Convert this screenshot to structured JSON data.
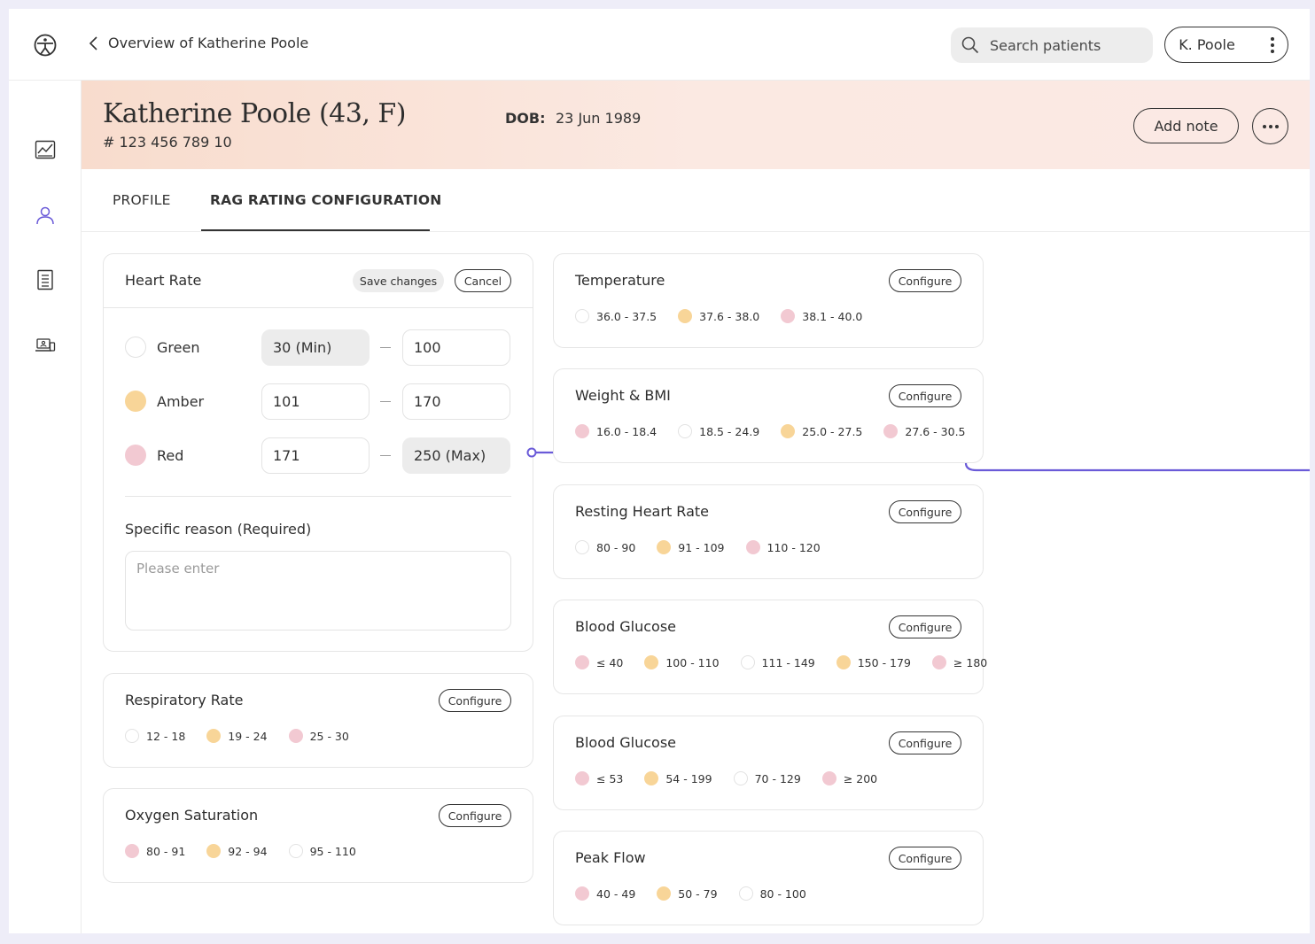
{
  "topbar": {
    "back_label": "Overview of Katherine Poole",
    "search_placeholder": "Search patients",
    "user_label": "K. Poole"
  },
  "sidebar": {
    "items": [
      {
        "name": "analytics",
        "icon": "chart-icon"
      },
      {
        "name": "patients",
        "icon": "user-icon",
        "active": true
      },
      {
        "name": "documents",
        "icon": "document-icon"
      },
      {
        "name": "devices",
        "icon": "devices-icon"
      }
    ]
  },
  "patient": {
    "name": "Katherine Poole (43, F)",
    "id": "# 123 456 789 10",
    "dob_label": "DOB:",
    "dob": "23 Jun 1989",
    "add_note_label": "Add note"
  },
  "tabs": [
    {
      "label": "PROFILE",
      "active": false
    },
    {
      "label": "RAG RATING CONFIGURATION",
      "active": true
    }
  ],
  "heart_rate": {
    "title": "Heart Rate",
    "save_label": "Save changes",
    "cancel_label": "Cancel",
    "rows": [
      {
        "label": "Green",
        "min": "30 (Min)",
        "max": "100"
      },
      {
        "label": "Amber",
        "min": "101",
        "max": "170"
      },
      {
        "label": "Red",
        "min": "171",
        "max": "250 (Max)"
      }
    ],
    "reason_label": "Specific reason (Required)",
    "reason_placeholder": "Please enter",
    "reason_value": ""
  },
  "configure_label": "Configure",
  "left_cards": [
    {
      "title": "Respiratory Rate",
      "chips": [
        {
          "color": "green",
          "text": "12 - 18"
        },
        {
          "color": "amber",
          "text": "19 - 24"
        },
        {
          "color": "red",
          "text": "25 - 30"
        }
      ]
    },
    {
      "title": "Oxygen Saturation",
      "chips": [
        {
          "color": "red",
          "text": "80 - 91"
        },
        {
          "color": "amber",
          "text": "92 - 94"
        },
        {
          "color": "green",
          "text": "95 - 110"
        }
      ]
    }
  ],
  "right_cards": [
    {
      "title": "Temperature",
      "chips": [
        {
          "color": "green",
          "text": "36.0 - 37.5"
        },
        {
          "color": "amber",
          "text": "37.6 - 38.0"
        },
        {
          "color": "red",
          "text": "38.1 - 40.0"
        }
      ]
    },
    {
      "title": "Weight & BMI",
      "chips": [
        {
          "color": "red",
          "text": "16.0 - 18.4"
        },
        {
          "color": "green",
          "text": "18.5 - 24.9"
        },
        {
          "color": "amber",
          "text": "25.0 - 27.5"
        },
        {
          "color": "red",
          "text": "27.6 - 30.5"
        }
      ]
    },
    {
      "title": "Resting Heart Rate",
      "chips": [
        {
          "color": "green",
          "text": "80 - 90"
        },
        {
          "color": "amber",
          "text": "91 - 109"
        },
        {
          "color": "red",
          "text": "110 - 120"
        }
      ]
    },
    {
      "title": "Blood Glucose",
      "chips": [
        {
          "color": "red",
          "text": "≤ 40"
        },
        {
          "color": "amber",
          "text": "100 - 110"
        },
        {
          "color": "green",
          "text": "111 - 149"
        },
        {
          "color": "amber",
          "text": "150 - 179"
        },
        {
          "color": "red",
          "text": "≥ 180"
        }
      ]
    },
    {
      "title": "Blood Glucose",
      "chips": [
        {
          "color": "red",
          "text": "≤ 53"
        },
        {
          "color": "amber",
          "text": "54 - 199"
        },
        {
          "color": "green",
          "text": "70 - 129"
        },
        {
          "color": "red",
          "text": "≥ 200"
        }
      ]
    },
    {
      "title": "Peak Flow",
      "chips": [
        {
          "color": "red",
          "text": "40 - 49"
        },
        {
          "color": "amber",
          "text": "50 - 79"
        },
        {
          "color": "green",
          "text": "80 - 100"
        }
      ]
    }
  ],
  "colors": {
    "accent": "#6a5ad8",
    "amber": "#f8d598",
    "red": "#f2c9d2",
    "green_outline": "#e2e2e2",
    "header_gradient_start": "#f8dccd",
    "header_gradient_end": "#fbe9e4"
  }
}
